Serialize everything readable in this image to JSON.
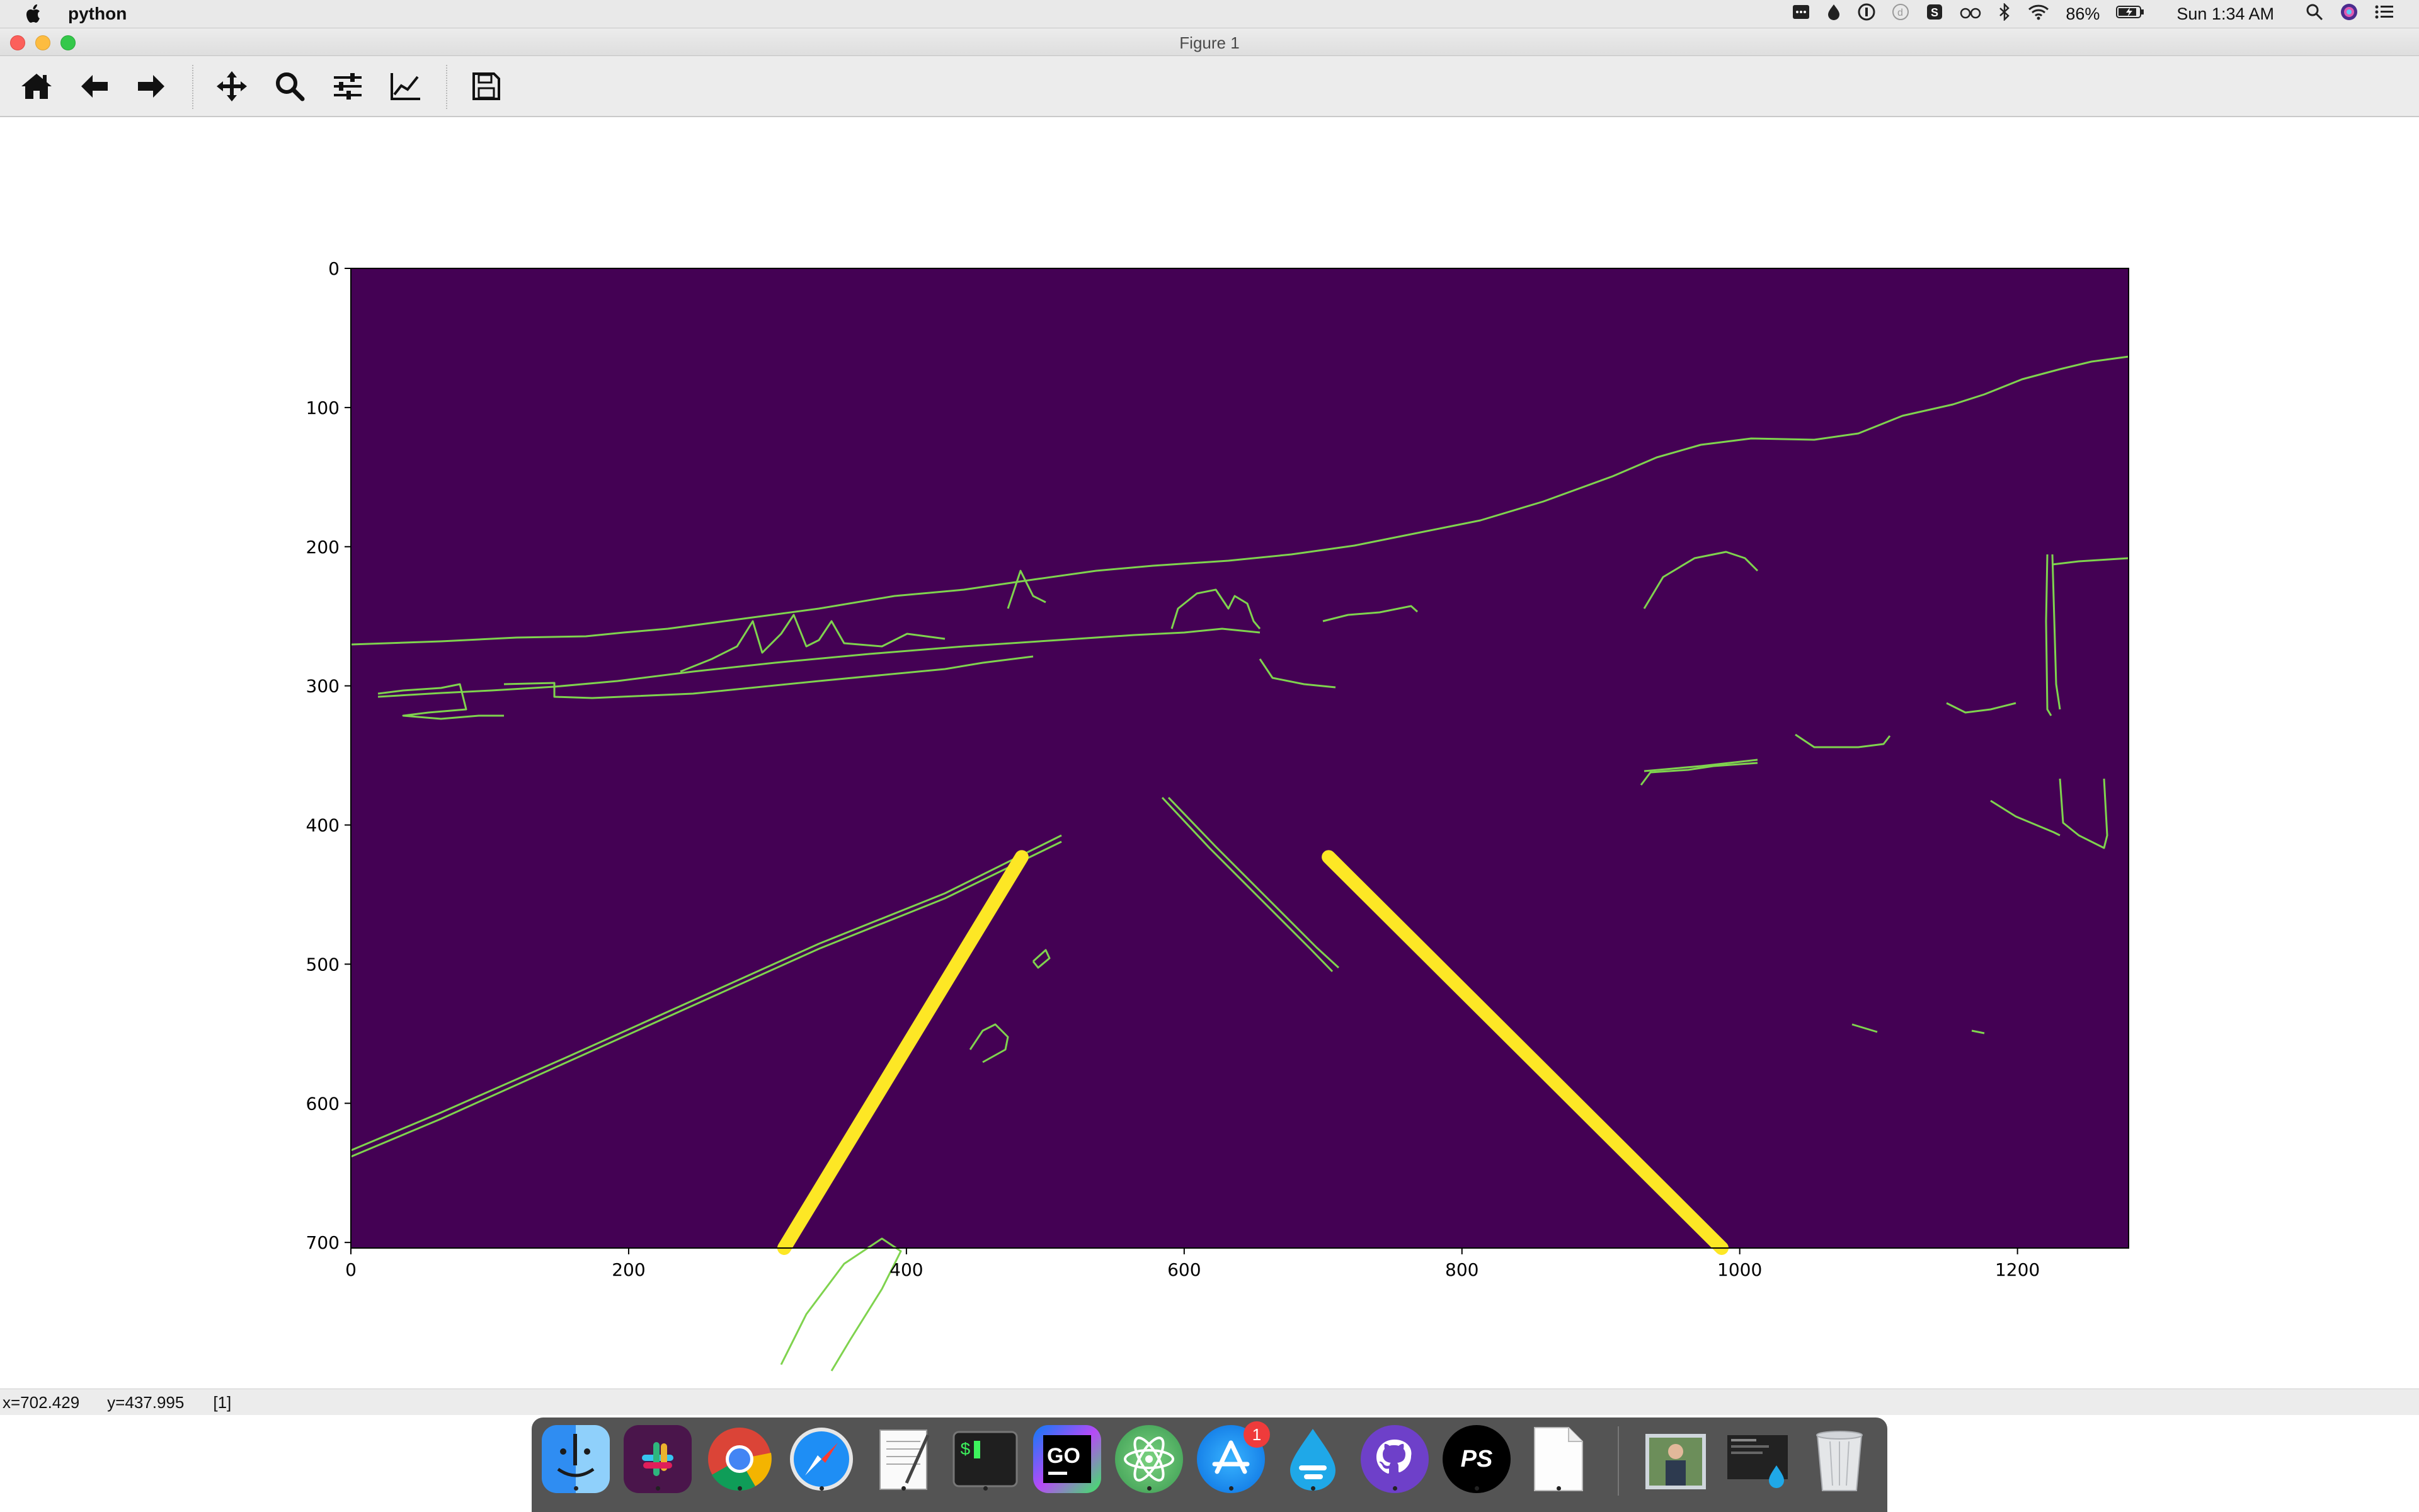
{
  "menubar": {
    "app_name": "python",
    "battery": "86%",
    "clock": "Sun 1:34 AM"
  },
  "window": {
    "title": "Figure 1"
  },
  "toolbar": {
    "buttons": [
      "home-icon",
      "back-arrow-icon",
      "forward-arrow-icon",
      "pan-icon",
      "zoom-icon",
      "subplots-config-icon",
      "edit-axes-icon",
      "save-icon"
    ]
  },
  "status": {
    "x": "x=702.429",
    "y": "y=437.995",
    "value": "[1]"
  },
  "colors": {
    "background": "#440154",
    "edge": "#7fd34e",
    "lane": "#fde725"
  },
  "chart_data": {
    "type": "image",
    "colormap": "viridis",
    "xlim": [
      0,
      1280
    ],
    "ylim": [
      704,
      0
    ],
    "xticks": [
      "0",
      "200",
      "400",
      "600",
      "800",
      "1000",
      "1200"
    ],
    "yticks": [
      "0",
      "100",
      "200",
      "300",
      "400",
      "500",
      "600",
      "700"
    ],
    "lane_lines": [
      {
        "from": [
          483,
          423
        ],
        "to": [
          312,
          704
        ]
      },
      {
        "from": [
          704,
          423
        ],
        "to": [
          987,
          704
        ]
      }
    ]
  },
  "dock": {
    "items": [
      "finder-icon",
      "slack-icon",
      "chrome-icon",
      "safari-icon",
      "textedit-icon",
      "terminal-icon",
      "goland-icon",
      "atom-icon",
      "app-store-icon",
      "drop-icon",
      "github-desktop-icon",
      "phpstorm-icon",
      "document-icon",
      "photo-stack-icon",
      "screenshot-stack-icon",
      "trash-icon"
    ],
    "app_store_badge": "1",
    "phpstorm_label": "PS",
    "goland_label": "GO"
  }
}
